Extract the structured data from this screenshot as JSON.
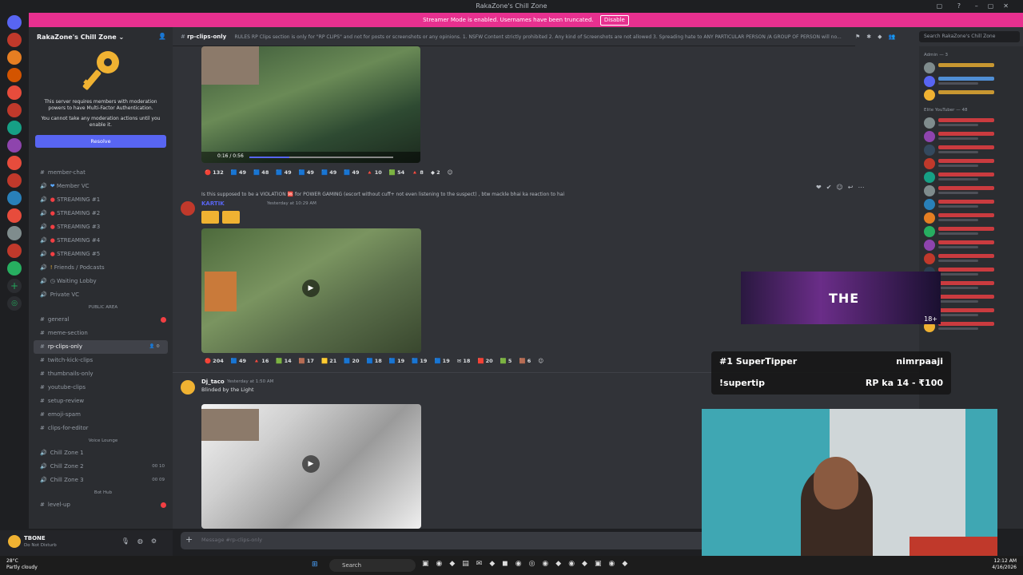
{
  "titlebar": {
    "title": "RakaZone's Chill Zone"
  },
  "streamer_bar": {
    "text": "Streamer Mode is enabled. Usernames have been truncated.",
    "disable_label": "Disable"
  },
  "server": {
    "name": "RakaZone's Chill Zone",
    "mfa_text1": "This server requires members with moderation powers to have Multi-Factor Authentication.",
    "mfa_text2": "You cannot take any moderation actions until you enable it.",
    "resolve_label": "Resolve"
  },
  "channels": [
    {
      "label": "member-chat",
      "type": "text"
    },
    {
      "label": "Member VC",
      "type": "voice"
    },
    {
      "label": "STREAMING #1",
      "type": "voice"
    },
    {
      "label": "STREAMING #2",
      "type": "voice"
    },
    {
      "label": "STREAMING #3",
      "type": "voice"
    },
    {
      "label": "STREAMING #4",
      "type": "voice"
    },
    {
      "label": "STREAMING #5",
      "type": "voice"
    },
    {
      "label": "Friends / Podcasts",
      "type": "voice"
    },
    {
      "label": "Waiting Lobby",
      "type": "voice"
    },
    {
      "label": "Private VC",
      "type": "voice"
    }
  ],
  "public_area": {
    "label": "PUBLIC AREA",
    "channels": [
      "general",
      "meme-section",
      "rp-clips-only",
      "twitch-kick-clips",
      "thumbnails-only",
      "youtube-clips",
      "setup-review",
      "emoji-spam",
      "clips-for-editor"
    ]
  },
  "voice_lounge": {
    "label": "Voice Lounge",
    "channels": [
      {
        "label": "Chill Zone 1",
        "count": ""
      },
      {
        "label": "Chill Zone 2",
        "count": "00 10"
      },
      {
        "label": "Chill Zone 3",
        "count": "00 09"
      }
    ]
  },
  "bot_hub": {
    "label": "Bot Hub",
    "channels": [
      "level-up"
    ]
  },
  "user": {
    "name": "TBONE",
    "status": "Do Not Disturb"
  },
  "chat_header": {
    "channel": "rp-clips-only",
    "topic": "RULES RP Clips section is only for \"RP CLIPS\" and not for posts or screenshots or any opinions. 1. NSFW Content strictly prohibited 2. Any kind of Screenshots are not allowed 3. Spreading hate to ANY PARTICULAR PERSON /A GROUP OF PERSON will no..."
  },
  "search": {
    "placeholder": "Search RakaZone's Chill Zone"
  },
  "video1": {
    "progress": "0:16 / 0:56"
  },
  "reactions1": [
    "132",
    "49",
    "48",
    "49",
    "49",
    "49",
    "49",
    "10",
    "54",
    "8",
    "2"
  ],
  "message2": {
    "reply": "Is this supposed to be a VIOLATION 🆘 for POWER GAMING (escort without cuff+ not even listening to the suspect) , btw mackle bhai ka reaction to hai",
    "author": "KARTIK",
    "time": "Yesterday at 10:29 AM"
  },
  "reactions2": [
    "204",
    "49",
    "16",
    "14",
    "17",
    "21",
    "20",
    "18",
    "19",
    "19",
    "19",
    "18",
    "20",
    "5",
    "6"
  ],
  "message3": {
    "author": "Dj_taco",
    "time": "Yesterday at 1:50 AM",
    "text": "Blinded by the Light"
  },
  "message_input": {
    "placeholder": "Message #rp-clips-only"
  },
  "members": {
    "admin": "Admin — 3",
    "elite": "Elite YouTuber — 48"
  },
  "overlay": {
    "text": "THE",
    "rating": "18+"
  },
  "tipper": {
    "rank": "#1 SuperTipper",
    "name": "nimrpaaji",
    "command": "!supertip",
    "amount": "RP ka 14 - ₹100"
  },
  "taskbar": {
    "temp": "28°C",
    "weather": "Partly cloudy",
    "search": "Search",
    "time": "12:12 AM",
    "date": "4/16/2026"
  },
  "colors": {
    "accent": "#5865f2",
    "streamer": "#e7308f",
    "mention": "#f23f43"
  }
}
